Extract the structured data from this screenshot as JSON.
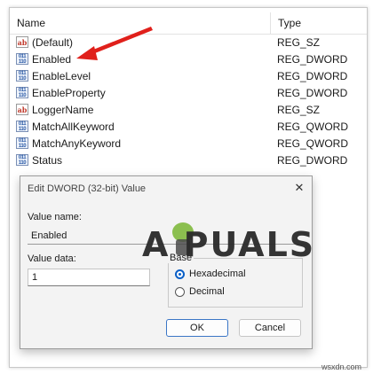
{
  "registry": {
    "columns": {
      "name": "Name",
      "type": "Type"
    },
    "rows": [
      {
        "name": "(Default)",
        "type": "REG_SZ",
        "icon": "string-value-icon"
      },
      {
        "name": "Enabled",
        "type": "REG_DWORD",
        "icon": "binary-value-icon"
      },
      {
        "name": "EnableLevel",
        "type": "REG_DWORD",
        "icon": "binary-value-icon"
      },
      {
        "name": "EnableProperty",
        "type": "REG_DWORD",
        "icon": "binary-value-icon"
      },
      {
        "name": "LoggerName",
        "type": "REG_SZ",
        "icon": "string-value-icon"
      },
      {
        "name": "MatchAllKeyword",
        "type": "REG_QWORD",
        "icon": "binary-value-icon"
      },
      {
        "name": "MatchAnyKeyword",
        "type": "REG_QWORD",
        "icon": "binary-value-icon"
      },
      {
        "name": "Status",
        "type": "REG_DWORD",
        "icon": "binary-value-icon"
      }
    ]
  },
  "dialog": {
    "title": "Edit DWORD (32-bit) Value",
    "value_name_label": "Value name:",
    "value_name": "Enabled",
    "value_data_label": "Value data:",
    "value_data": "1",
    "base_label": "Base",
    "base_options": [
      {
        "label": "Hexadecimal",
        "selected": true
      },
      {
        "label": "Decimal",
        "selected": false
      }
    ],
    "ok_label": "OK",
    "cancel_label": "Cancel"
  },
  "watermark": {
    "text": "A  PUALS",
    "site": "wsxdn.com"
  },
  "colors": {
    "arrow": "#e0201b",
    "accent": "#0a5fc7"
  }
}
